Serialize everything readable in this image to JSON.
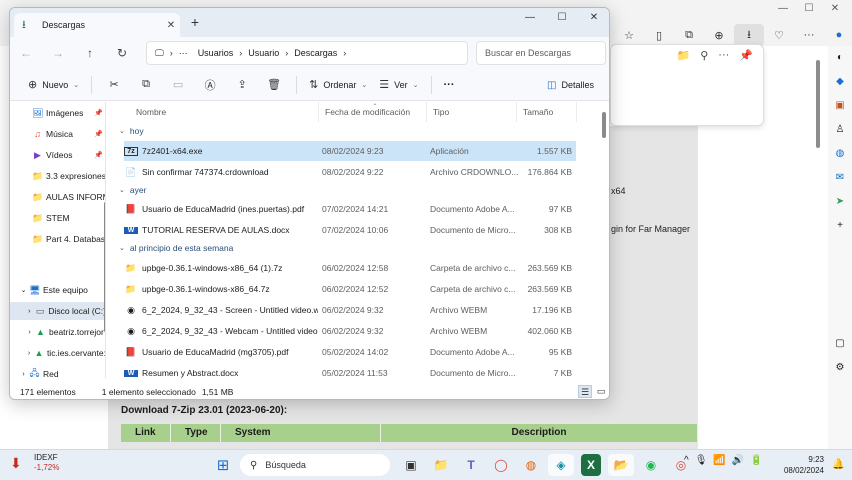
{
  "browser": {
    "window_controls": [
      "—",
      "☐",
      "✕"
    ],
    "toolbar_icons": [
      "☆",
      "▯",
      "⧉",
      "⊕",
      "⭳",
      "♡",
      "···",
      "●"
    ],
    "sidebar_icons": [
      "◐",
      "◆",
      "▣",
      "♙",
      "◍",
      "✉",
      "➤",
      "+",
      "▢",
      "⚙"
    ],
    "popup_icons": [
      "📁",
      "⚲",
      "···",
      "📌"
    ],
    "page_snippets": {
      "text1": "x64",
      "text2": "gin for Far Manager"
    },
    "download_title": "Download 7-Zip 23.01 (2023-06-20):",
    "table_headers": [
      "Link",
      "Type",
      "System",
      "Description"
    ],
    "colors": {
      "table_header_bg": "#a8d08d",
      "page_bg": "#e5e5e5"
    }
  },
  "explorer": {
    "tab_title": "Descargas",
    "new_tab": "+",
    "window_controls": [
      "—",
      "☐",
      "✕"
    ],
    "nav": {
      "back": "←",
      "forward": "→",
      "up": "↑",
      "refresh": "↻",
      "pc_icon": "🖵",
      "more": "···"
    },
    "address": {
      "separator": "›",
      "crumbs": [
        "Usuarios",
        "Usuario",
        "Descargas"
      ]
    },
    "search_placeholder": "Buscar en Descargas",
    "commands": {
      "new_label": "Nuevo",
      "sort_label": "Ordenar",
      "view_label": "Ver",
      "more": "···",
      "details_label": "Detalles"
    },
    "nav_pane": [
      {
        "icon": "🖼",
        "label": "Imágenes",
        "pinned": true
      },
      {
        "icon": "♫",
        "label": "Música",
        "pinned": true
      },
      {
        "icon": "▶",
        "label": "Vídeos",
        "pinned": true
      },
      {
        "icon": "📁",
        "label": "3.3 expresiones",
        "pinned": false
      },
      {
        "icon": "📁",
        "label": "AULAS INFORM",
        "pinned": false
      },
      {
        "icon": "📁",
        "label": "STEM",
        "pinned": false
      },
      {
        "icon": "📁",
        "label": "Part 4. Database",
        "pinned": false
      },
      {
        "icon": "🖥",
        "label": "Este equipo",
        "pinned": false
      },
      {
        "icon": "▭",
        "label": "Disco local (C:)",
        "pinned": false
      },
      {
        "icon": "▲",
        "label": "beatriz.torrejor",
        "pinned": false
      },
      {
        "icon": "▲",
        "label": "tic.ies.cervante:",
        "pinned": false
      },
      {
        "icon": "🖧",
        "label": "Red",
        "pinned": false
      }
    ],
    "columns": [
      "Nombre",
      "Fecha de modificación",
      "Tipo",
      "Tamaño"
    ],
    "groups": [
      "hoy",
      "ayer",
      "al principio de esta semana"
    ],
    "files": [
      {
        "icon": "7z",
        "name": "7z2401-x64.exe",
        "date": "08/02/2024 9:23",
        "type": "Aplicación",
        "size": "1.557 KB",
        "selected": true
      },
      {
        "icon": "📄",
        "name": "Sin confirmar 747374.crdownload",
        "date": "08/02/2024 9:22",
        "type": "Archivo CRDOWNLO...",
        "size": "176.864 KB",
        "selected": false
      },
      {
        "icon": "📕",
        "name": "Usuario de EducaMadrid (ines.puertas).pdf",
        "date": "07/02/2024 14:21",
        "type": "Documento Adobe A...",
        "size": "97 KB",
        "selected": false
      },
      {
        "icon": "W",
        "name": "TUTORIAL RESERVA DE AULAS.docx",
        "date": "07/02/2024 10:06",
        "type": "Documento de Micro...",
        "size": "308 KB",
        "selected": false
      },
      {
        "icon": "📁",
        "name": "upbge-0.36.1-windows-x86_64 (1).7z",
        "date": "06/02/2024 12:58",
        "type": "Carpeta de archivo c...",
        "size": "263.569 KB",
        "selected": false
      },
      {
        "icon": "📁",
        "name": "upbge-0.36.1-windows-x86_64.7z",
        "date": "06/02/2024 12:52",
        "type": "Carpeta de archivo c...",
        "size": "263.569 KB",
        "selected": false
      },
      {
        "icon": "◉",
        "name": "6_2_2024, 9_32_43 - Screen - Untitled video.we...",
        "date": "06/02/2024 9:32",
        "type": "Archivo WEBM",
        "size": "17.196 KB",
        "selected": false
      },
      {
        "icon": "◉",
        "name": "6_2_2024, 9_32_43 - Webcam - Untitled video.w...",
        "date": "06/02/2024 9:32",
        "type": "Archivo WEBM",
        "size": "402.060 KB",
        "selected": false
      },
      {
        "icon": "📕",
        "name": "Usuario de EducaMadrid (mg3705).pdf",
        "date": "05/02/2024 14:02",
        "type": "Documento Adobe A...",
        "size": "95 KB",
        "selected": false
      },
      {
        "icon": "W",
        "name": "Resumen y Abstract.docx",
        "date": "05/02/2024 11:53",
        "type": "Documento de Micro...",
        "size": "7 KB",
        "selected": false
      }
    ],
    "status": {
      "count": "171 elementos",
      "selection": "1 elemento seleccionado",
      "size": "1,51 MB"
    }
  },
  "taskbar": {
    "stock_name": "IDEXF",
    "stock_change": "-1,72%",
    "search_label": "Búsqueda",
    "apps": [
      "⊞",
      "▣",
      "📁",
      "T",
      "◯",
      "◍",
      "◈",
      "X",
      "📂",
      "◉",
      "◎"
    ],
    "tray": [
      "^",
      "🎙",
      "📶",
      "🔊",
      "🔋"
    ],
    "time": "9:23",
    "date": "08/02/2024"
  }
}
